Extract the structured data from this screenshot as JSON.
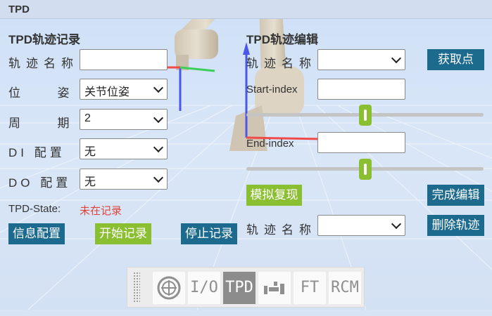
{
  "header": {
    "title": "TPD"
  },
  "record": {
    "title": "TPD轨迹记录",
    "name_label": "轨迹名称",
    "name_value": "",
    "pose_label": "位姿",
    "pose_value": "关节位姿",
    "period_label": "周期",
    "period_value": "2",
    "di_label": "DI 配置",
    "di_value": "无",
    "do_label": "DO 配置",
    "do_value": "无",
    "state_label": "TPD-State:",
    "state_value": "未在记录",
    "btn_info": "信息配置",
    "btn_start": "开始记录",
    "btn_stop": "停止记录"
  },
  "edit": {
    "title": "TPD轨迹编辑",
    "name_label": "轨迹名称",
    "name_value": "",
    "btn_get_point": "获取点",
    "start_label": "Start-index",
    "start_value": "",
    "start_slider": 0.5,
    "end_label": "End-index",
    "end_value": "",
    "end_slider": 0.5,
    "btn_simulate": "模拟复现",
    "btn_finish": "完成编辑",
    "delete_name_label": "轨迹名称",
    "delete_name_value": "",
    "btn_delete": "删除轨迹"
  },
  "toolbar": {
    "items": [
      {
        "icon": "target-icon",
        "label": ""
      },
      {
        "icon": "io-icon",
        "label": "I/O"
      },
      {
        "icon": "tpd-icon",
        "label": "TPD",
        "active": true
      },
      {
        "icon": "robot-arm-icon",
        "label": ""
      },
      {
        "icon": "ft-icon",
        "label": "FT"
      },
      {
        "icon": "rcm-icon",
        "label": "RCM"
      }
    ]
  },
  "colors": {
    "accent_dark": "#1d6a8f",
    "accent_green": "#8bbf32",
    "state_red": "#e0433a",
    "background": "#d6e4f6"
  }
}
